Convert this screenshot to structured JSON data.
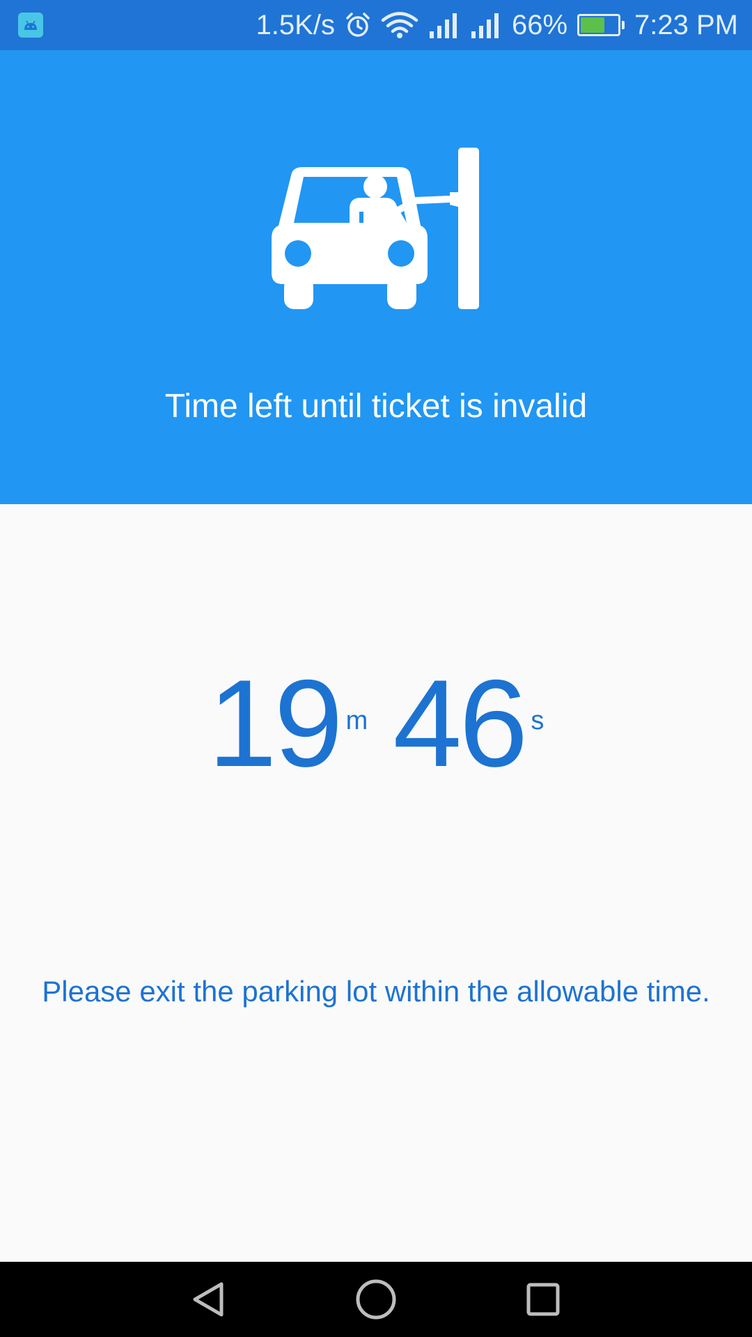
{
  "status_bar": {
    "app_icon": "android-icon",
    "network_speed": "1.5K/s",
    "icons": [
      "alarm-icon",
      "wifi-icon",
      "signal-icon",
      "signal-icon"
    ],
    "battery_percent": "66%",
    "battery_level": 0.66,
    "time": "7:23 PM"
  },
  "header": {
    "icon": "parking-ticket-car-icon",
    "title": "Time left until ticket is invalid",
    "background": "#2196f3"
  },
  "timer": {
    "minutes": "19",
    "minutes_unit": "m",
    "seconds": "46",
    "seconds_unit": "s",
    "color": "#1d73d1"
  },
  "message": "Please exit the parking lot within the allowable time.",
  "nav_bar": {
    "back": "back-icon",
    "home": "home-icon",
    "recents": "recents-icon"
  }
}
